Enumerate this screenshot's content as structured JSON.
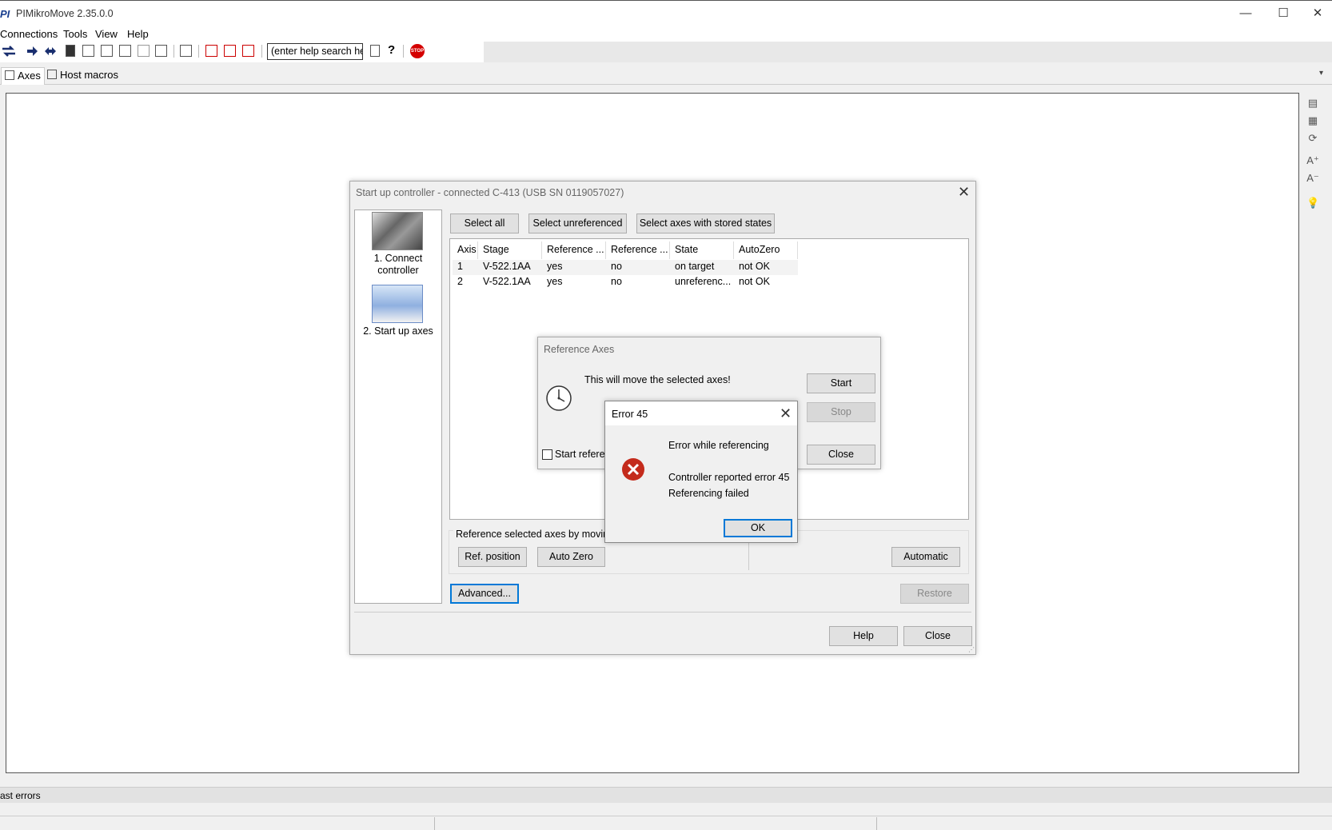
{
  "app": {
    "logo": "PI",
    "title": "PIMikroMove  2.35.0.0",
    "window_controls": {
      "minimize": "—",
      "maximize": "☐",
      "close": "✕"
    }
  },
  "menu": [
    "Connections",
    "Tools",
    "View",
    "Help"
  ],
  "toolbar": {
    "search_placeholder": "(enter help search he",
    "icons": [
      "connect-icon",
      "move-right-icon",
      "move-both-icon",
      "positioner-icon",
      "single-axis-icon",
      "terminal-icon",
      "graph-icon",
      "data-recorder-icon",
      "macro-icon",
      "panel-icon",
      "waveform-icon",
      "trigger-icon",
      "scan-icon",
      "search-help-icon",
      "help-icon",
      "stop-icon"
    ],
    "stop_label": "STOP"
  },
  "tabs": [
    {
      "label": "Axes",
      "active": true
    },
    {
      "label": "Host macros",
      "active": false
    }
  ],
  "right_sidebar_icons": [
    "panel-list-icon",
    "panel-grid-icon",
    "refresh-icon",
    "font-larger-icon",
    "font-smaller-icon",
    "tip-icon"
  ],
  "statusbar": {
    "text": "ast errors"
  },
  "startup_dialog": {
    "title": "Start up controller - connected C-413 (USB SN 0119057027)",
    "steps": [
      {
        "label_line1": "1. Connect",
        "label_line2": "controller"
      },
      {
        "label_line1": "2. Start up axes",
        "label_line2": ""
      }
    ],
    "select_all": "Select all",
    "select_unreferenced": "Select unreferenced",
    "select_stored": "Select axes with stored states",
    "columns": [
      "Axis",
      "Stage",
      "Reference ...",
      "Reference ...",
      "State",
      "AutoZero"
    ],
    "rows": [
      [
        "1",
        "V-522.1AA",
        "yes",
        "no",
        "on target",
        "not OK"
      ],
      [
        "2",
        "V-522.1AA",
        "yes",
        "no",
        "unreferenc...",
        "not OK"
      ]
    ],
    "group_label": "Reference selected axes by moving",
    "ref_position": "Ref. position",
    "auto_zero": "Auto Zero",
    "automatic": "Automatic",
    "advanced": "Advanced...",
    "restore": "Restore",
    "help": "Help",
    "close": "Close"
  },
  "reference_dialog": {
    "title": "Reference Axes",
    "message": "This will move the selected axes!",
    "start": "Start",
    "stop": "Stop",
    "checkbox_label": "Start referen",
    "close": "Close"
  },
  "error_dialog": {
    "title": "Error 45",
    "line1": "Error while referencing",
    "line2": "Controller reported error 45",
    "line3": "Referencing failed",
    "ok": "OK"
  },
  "colors": {
    "focus": "#0078d7",
    "error_icon": "#c42b1c",
    "stop_icon": "#d40000"
  }
}
